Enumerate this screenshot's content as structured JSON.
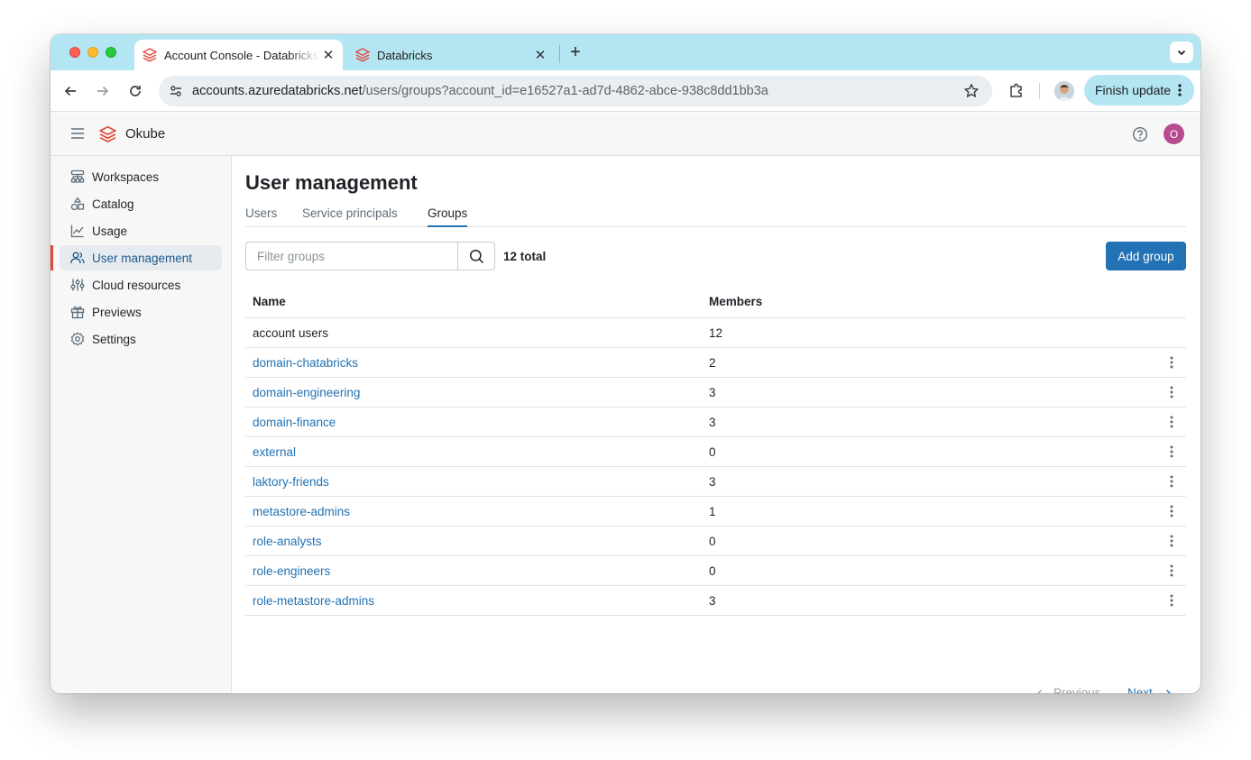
{
  "browser": {
    "tabs": [
      {
        "title": "Account Console - Databricks",
        "active": true
      },
      {
        "title": "Databricks",
        "active": false
      }
    ],
    "url_host": "accounts.azuredatabricks.net",
    "url_path": "/users/groups?account_id=e16527a1-ad7d-4862-abce-938c8dd1bb3a",
    "finish_update_label": "Finish update"
  },
  "header": {
    "brand": "Okube",
    "avatar_initial": "O"
  },
  "sidebar": {
    "items": [
      {
        "label": "Workspaces",
        "icon": "workspaces-icon"
      },
      {
        "label": "Catalog",
        "icon": "catalog-icon"
      },
      {
        "label": "Usage",
        "icon": "usage-chart-icon"
      },
      {
        "label": "User management",
        "icon": "users-icon",
        "active": true
      },
      {
        "label": "Cloud resources",
        "icon": "sliders-icon"
      },
      {
        "label": "Previews",
        "icon": "gift-icon"
      },
      {
        "label": "Settings",
        "icon": "gear-icon"
      }
    ]
  },
  "main": {
    "title": "User management",
    "tabs": [
      {
        "label": "Users"
      },
      {
        "label": "Service principals"
      },
      {
        "label": "Groups",
        "active": true
      }
    ],
    "filter_placeholder": "Filter groups",
    "total": "12 total",
    "add_button": "Add group",
    "table": {
      "headers": [
        "Name",
        "Members"
      ],
      "rows": [
        {
          "name": "account users",
          "members": "12",
          "link": false
        },
        {
          "name": "domain-chatabricks",
          "members": "2",
          "link": true
        },
        {
          "name": "domain-engineering",
          "members": "3",
          "link": true
        },
        {
          "name": "domain-finance",
          "members": "3",
          "link": true
        },
        {
          "name": "external",
          "members": "0",
          "link": true
        },
        {
          "name": "laktory-friends",
          "members": "3",
          "link": true
        },
        {
          "name": "metastore-admins",
          "members": "1",
          "link": true
        },
        {
          "name": "role-analysts",
          "members": "0",
          "link": true
        },
        {
          "name": "role-engineers",
          "members": "0",
          "link": true
        },
        {
          "name": "role-metastore-admins",
          "members": "3",
          "link": true
        }
      ]
    },
    "pager": {
      "previous": "Previous",
      "next": "Next"
    }
  },
  "colors": {
    "accent": "#2272b4",
    "brand_red": "#e0483b",
    "tab_strip": "#b3e5f2",
    "avatar": "#b84a8f"
  }
}
